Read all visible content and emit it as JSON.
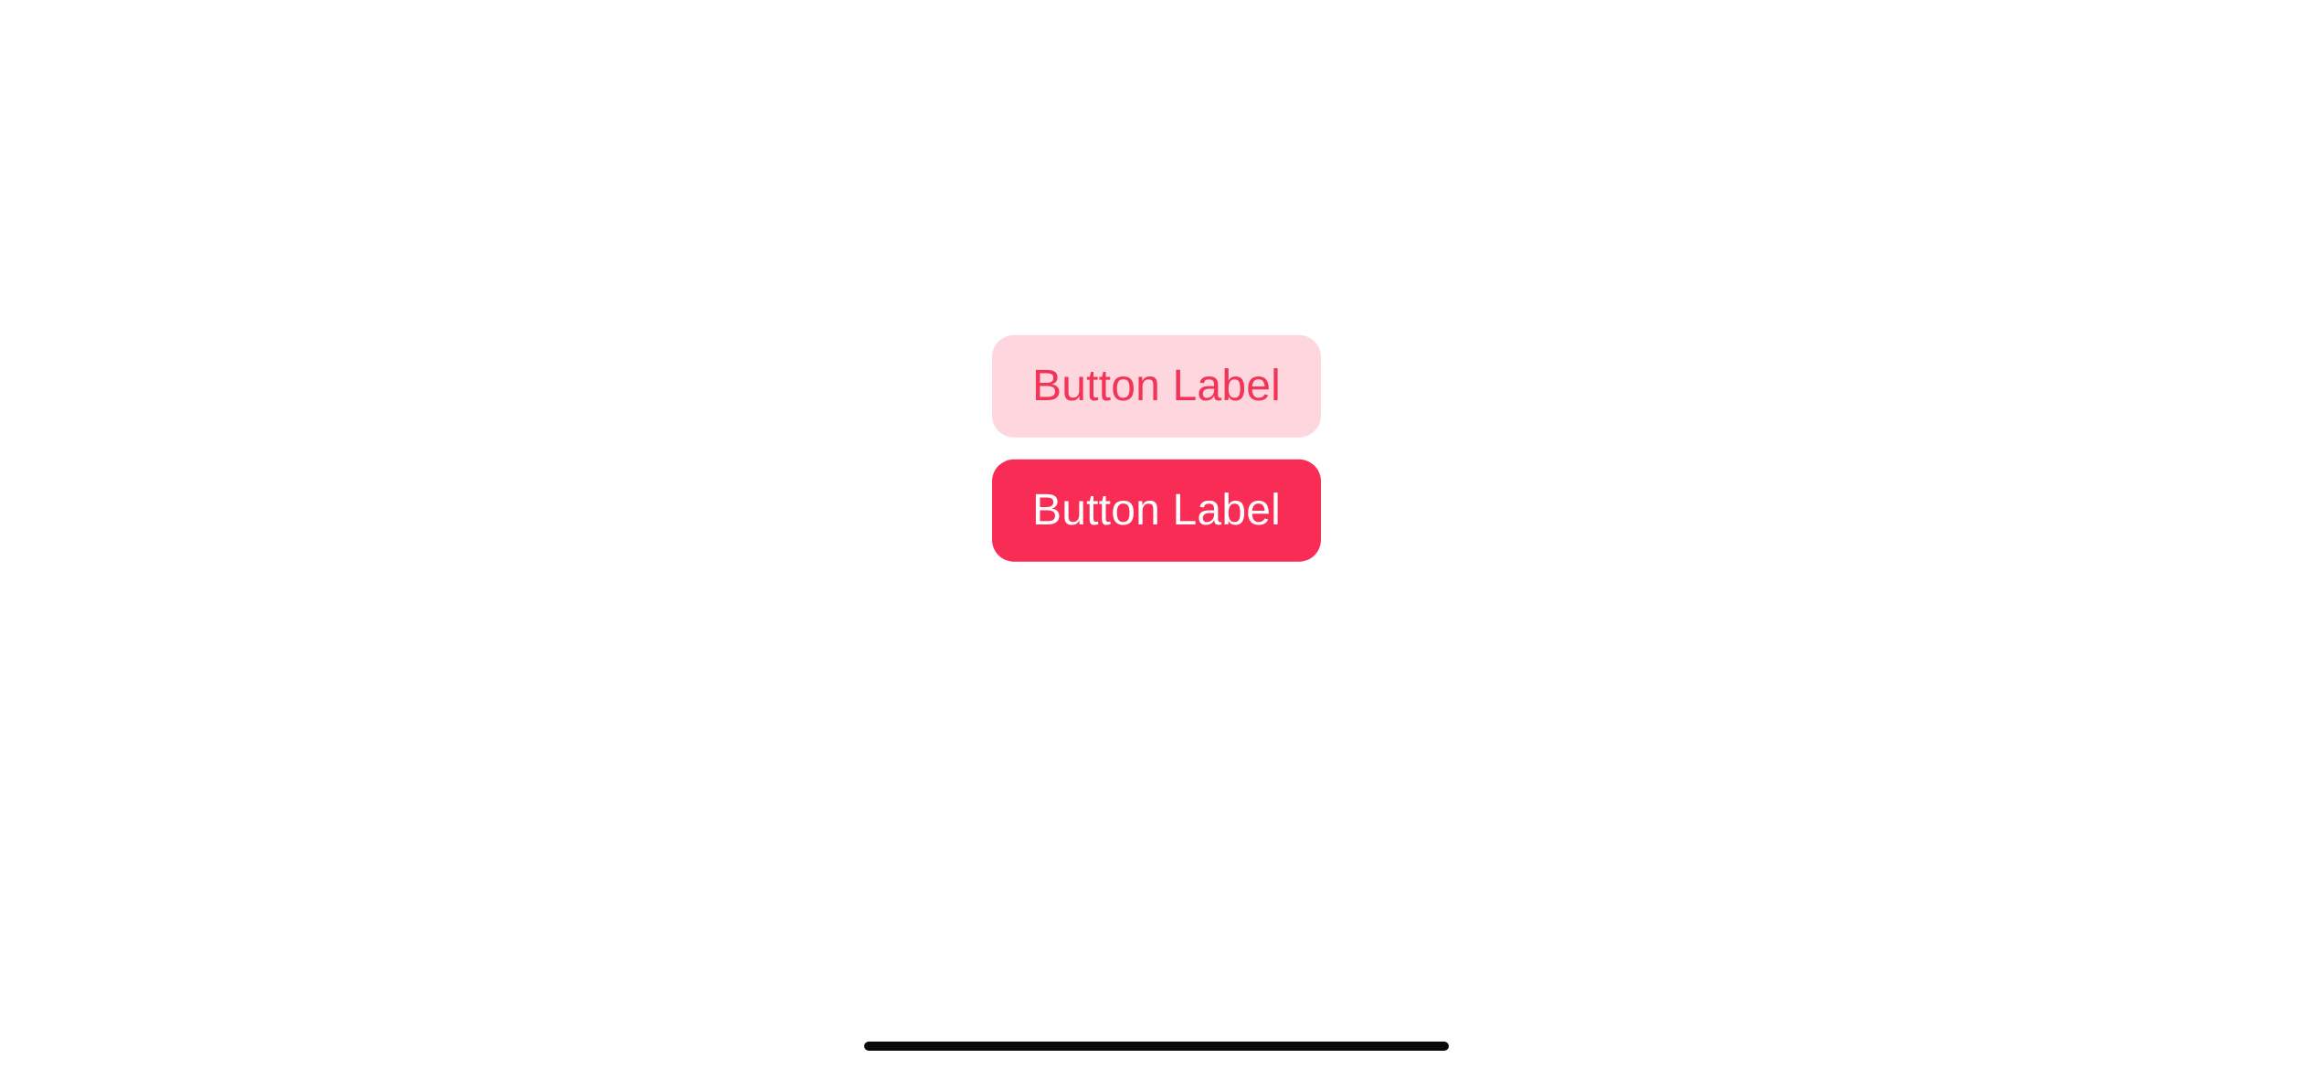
{
  "buttons": {
    "tinted": {
      "label": "Button Label"
    },
    "filled": {
      "label": "Button Label"
    }
  },
  "colors": {
    "accent": "#f92c55",
    "accent_tint_bg": "#fdd6de",
    "accent_tint_fg": "#f33459"
  }
}
